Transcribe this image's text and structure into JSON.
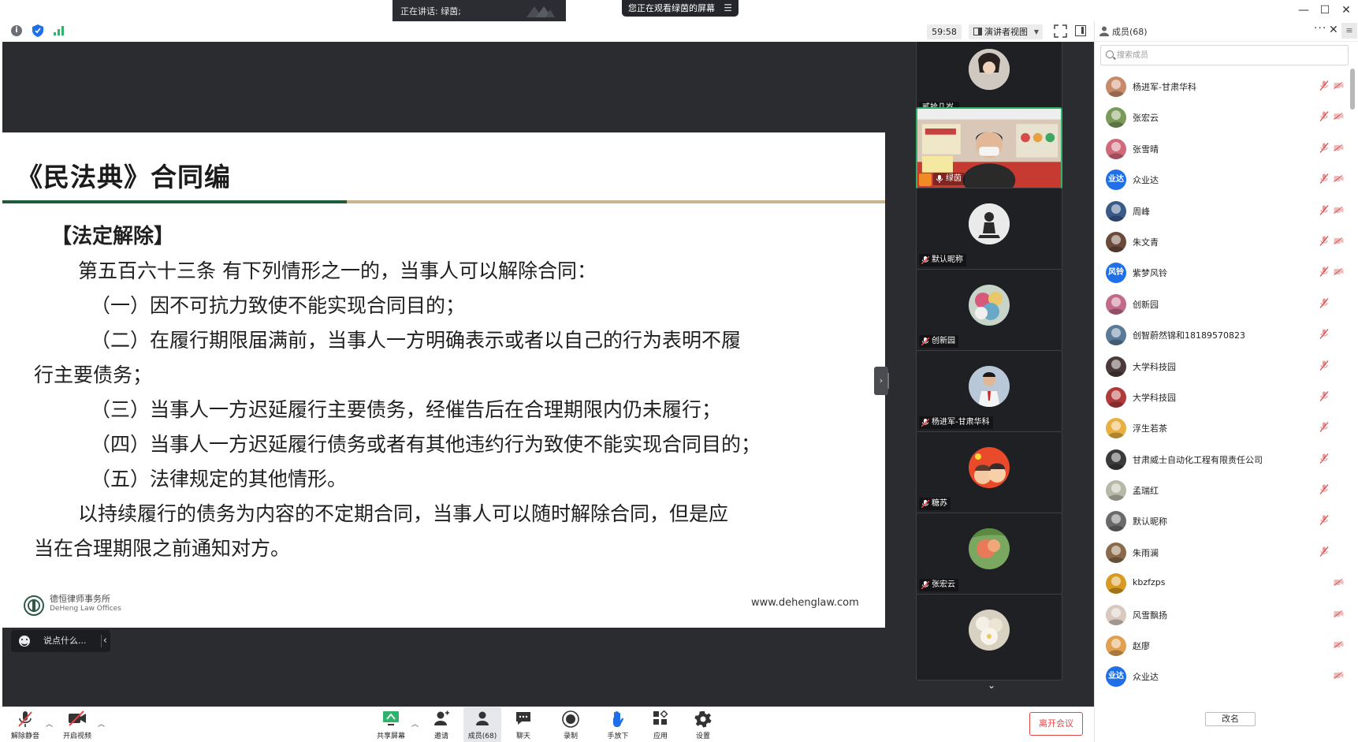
{
  "titlebar": {
    "speaking_label": "正在讲话: 绿茵;",
    "watching_label": "您正在观看绿茵的屏幕"
  },
  "toolbar": {
    "timer": "59:58",
    "view_label": "演讲者视图"
  },
  "slide": {
    "title": "《民法典》合同编",
    "heading": "【法定解除】",
    "p1": "第五百六十三条 有下列情形之一的，当事人可以解除合同：",
    "item1": "（一）因不可抗力致使不能实现合同目的；",
    "item2a": "（二）在履行期限届满前，当事人一方明确表示或者以自己的行为表明不履",
    "item2b": "行主要债务；",
    "item3": "（三）当事人一方迟延履行主要债务，经催告后在合理期限内仍未履行；",
    "item4": "（四）当事人一方迟延履行债务或者有其他违约行为致使不能实现合同目的；",
    "item5": "（五）法律规定的其他情形。",
    "p2a": "以持续履行的债务为内容的不定期合同，当事人可以随时解除合同，但是应",
    "p2b": "当在合理期限之前通知对方。",
    "firm_name_cn": "德恒律师事务所",
    "firm_name_en": "DeHeng Law Offices",
    "firm_url": "www.dehenglaw.com"
  },
  "chat": {
    "placeholder": "说点什么..."
  },
  "video_tiles": [
    {
      "name": "贰拾几岁."
    },
    {
      "name": "绿茵"
    },
    {
      "name": "默认昵称"
    },
    {
      "name": "创新园"
    },
    {
      "name": "杨进军-甘肃华科"
    },
    {
      "name": "糖苏"
    },
    {
      "name": "张宏云"
    }
  ],
  "panel": {
    "title": "成员(68)",
    "search_placeholder": "搜索成员",
    "rename_label": "改名",
    "members": [
      {
        "name": "杨进军-甘肃华科",
        "badge": "",
        "color": "#c98a6a"
      },
      {
        "name": "张宏云",
        "badge": "",
        "color": "#7a9a5a"
      },
      {
        "name": "张雪晴",
        "badge": "",
        "color": "#d06a7a"
      },
      {
        "name": "众业达",
        "badge": "业达",
        "color": "#1e6fe8"
      },
      {
        "name": "周峰",
        "badge": "",
        "color": "#3a5a8a"
      },
      {
        "name": "朱文青",
        "badge": "",
        "color": "#6a4a3a"
      },
      {
        "name": "紫梦风铃",
        "badge": "风铃",
        "color": "#1e6fe8"
      },
      {
        "name": "创新园",
        "badge": "",
        "color": "#c26a8a"
      },
      {
        "name": "创智蔚然锦和18189570823",
        "badge": "",
        "color": "#5a7a9a"
      },
      {
        "name": "大学科技园",
        "badge": "",
        "color": "#4a3a3a"
      },
      {
        "name": "大学科技园",
        "badge": "",
        "color": "#b03a3a"
      },
      {
        "name": "浮生若茶",
        "badge": "",
        "color": "#e8b040"
      },
      {
        "name": "甘肃威士自动化工程有限责任公司",
        "badge": "",
        "color": "#3a3a3a"
      },
      {
        "name": "孟瑞红",
        "badge": "",
        "color": "#b8b8a8"
      },
      {
        "name": "默认昵称",
        "badge": "",
        "color": "#6a6a6a"
      },
      {
        "name": "朱雨澜",
        "badge": "",
        "color": "#8a6a4a"
      },
      {
        "name": "kbzfzps",
        "badge": "",
        "color": "#d89a20"
      },
      {
        "name": "风雪飘扬",
        "badge": "",
        "color": "#d8c8c0"
      },
      {
        "name": "赵廖",
        "badge": "",
        "color": "#e0a050"
      },
      {
        "name": "众业达",
        "badge": "业达",
        "color": "#1e6fe8"
      }
    ]
  },
  "bottombar": {
    "unmute": "解除静音",
    "video": "开启视频",
    "share": "共享屏幕",
    "invite": "邀请",
    "members": "成员(68)",
    "chat": "聊天",
    "record": "录制",
    "raise_hand": "手放下",
    "apps": "应用",
    "settings": "设置",
    "leave": "离开会议"
  }
}
